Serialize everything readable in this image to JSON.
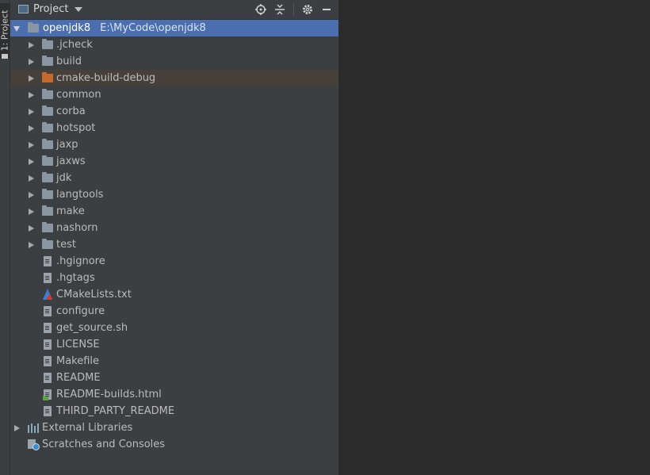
{
  "sidebar_tab": {
    "label": "1: Project"
  },
  "header": {
    "title": "Project",
    "tools": [
      "locate-icon",
      "collapse-all-icon",
      "settings-icon",
      "hide-icon"
    ]
  },
  "tree": {
    "root": {
      "name": "openjdk8",
      "path": "E:\\MyCode\\openjdk8"
    },
    "folders": [
      {
        "name": ".jcheck"
      },
      {
        "name": "build"
      },
      {
        "name": "cmake-build-debug",
        "color": "#c46a2c"
      },
      {
        "name": "common"
      },
      {
        "name": "corba"
      },
      {
        "name": "hotspot"
      },
      {
        "name": "jaxp"
      },
      {
        "name": "jaxws"
      },
      {
        "name": "jdk"
      },
      {
        "name": "langtools"
      },
      {
        "name": "make"
      },
      {
        "name": "nashorn"
      },
      {
        "name": "test"
      }
    ],
    "files": [
      {
        "name": ".hgignore",
        "icon": "text-file-icon"
      },
      {
        "name": ".hgtags",
        "icon": "text-file-icon"
      },
      {
        "name": "CMakeLists.txt",
        "icon": "cmake-icon"
      },
      {
        "name": "configure",
        "icon": "text-file-icon"
      },
      {
        "name": "get_source.sh",
        "icon": "text-file-icon"
      },
      {
        "name": "LICENSE",
        "icon": "text-file-icon"
      },
      {
        "name": "Makefile",
        "icon": "text-file-icon"
      },
      {
        "name": "README",
        "icon": "text-file-icon"
      },
      {
        "name": "README-builds.html",
        "icon": "html-file-icon"
      },
      {
        "name": "THIRD_PARTY_README",
        "icon": "text-file-icon"
      }
    ],
    "external_libraries": "External Libraries",
    "scratches": "Scratches and Consoles"
  },
  "colors": {
    "selection": "#4b6eaf",
    "panel_bg": "#3c3f41",
    "editor_bg": "#2b2b2b",
    "highlight_row": "#45403a"
  }
}
